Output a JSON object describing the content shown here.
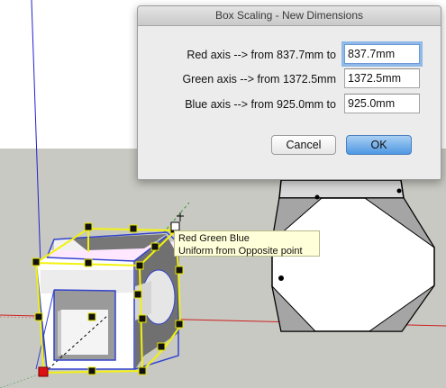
{
  "dialog": {
    "title": "Box Scaling - New Dimensions",
    "rows": [
      {
        "label": "Red axis --> from 837.7mm to",
        "value": "837.7mm"
      },
      {
        "label": "Green axis --> from 1372.5mm",
        "value": "1372.5mm"
      },
      {
        "label": "Blue axis --> from 925.0mm to",
        "value": "925.0mm"
      }
    ],
    "cancel_label": "Cancel",
    "ok_label": "OK"
  },
  "tooltip": {
    "line1": "Red Green Blue",
    "line2": "Uniform from Opposite point"
  },
  "colors": {
    "sky": "#ffffff",
    "ground": "#c9c9c3",
    "red_axis": "#cc2020",
    "green_axis": "#2f9a2f",
    "blue_axis": "#2222cc",
    "selection_box": "#f2f20f",
    "highlight": "#ffe8ff"
  }
}
